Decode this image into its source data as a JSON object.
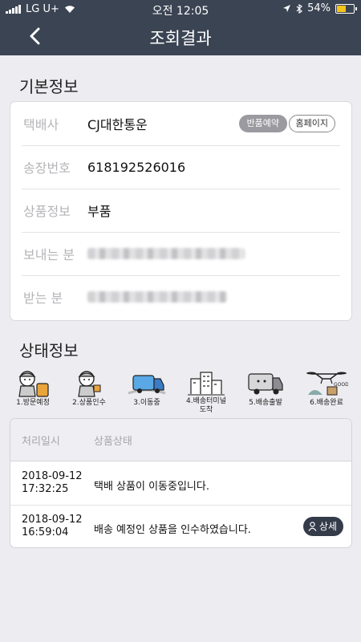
{
  "status_bar": {
    "carrier": "LG U+",
    "time": "오전 12:05",
    "battery": "54%"
  },
  "nav": {
    "title": "조회결과"
  },
  "basic_info": {
    "title": "기본정보",
    "rows": [
      {
        "label": "택배사",
        "value": "CJ대한통운"
      },
      {
        "label": "송장번호",
        "value": "618192526016"
      },
      {
        "label": "상품정보",
        "value": "부품"
      },
      {
        "label": "보내는 분",
        "value": ""
      },
      {
        "label": "받는 분",
        "value": ""
      }
    ],
    "return_button": "반품예약",
    "homepage_button": "홈페이지"
  },
  "status_info": {
    "title": "상태정보",
    "steps": [
      {
        "label": "1.방문예정",
        "icon": "courier-visit-icon"
      },
      {
        "label": "2.상품인수",
        "icon": "courier-pickup-icon"
      },
      {
        "label": "3.이동중",
        "icon": "truck-moving-icon"
      },
      {
        "label": "4.배송터미널 도착",
        "icon": "terminal-building-icon"
      },
      {
        "label": "5.배송출발",
        "icon": "truck-departure-icon"
      },
      {
        "label": "6.배송완료",
        "icon": "drone-delivery-icon"
      }
    ],
    "table": {
      "headers": [
        "처리일시",
        "상품상태"
      ],
      "rows": [
        {
          "date": "2018-09-12",
          "time": "17:32:25",
          "status": "택배 상품이 이동중입니다."
        },
        {
          "date": "2018-09-12",
          "time": "16:59:04",
          "status": "배송 예정인 상품을 인수하였습니다.",
          "action": "상세"
        }
      ]
    }
  },
  "colors": {
    "header_bg": "#3b4453",
    "page_bg": "#ededf1",
    "detail_button_bg": "#343c4a"
  }
}
